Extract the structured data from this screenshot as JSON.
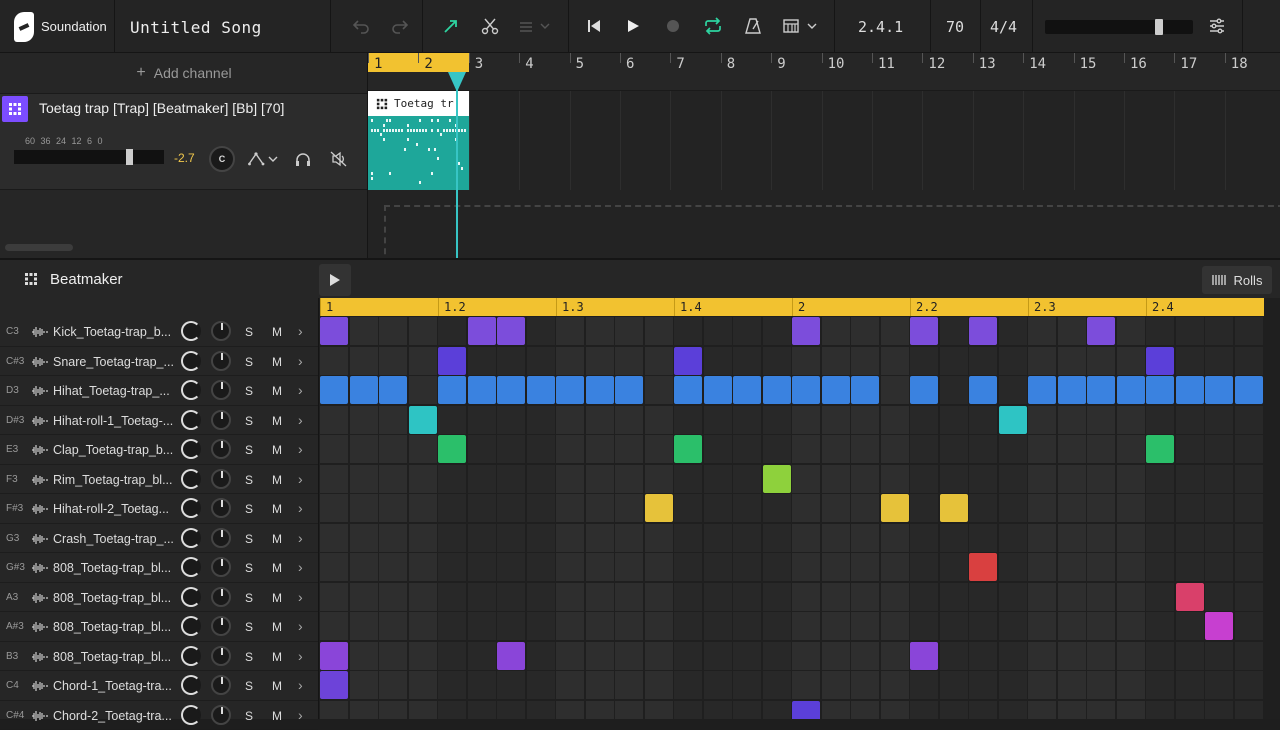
{
  "app": {
    "name": "Soundation",
    "song_title": "Untitled Song"
  },
  "toolbar": {
    "position": "2.4.1",
    "tempo": "70",
    "time_signature": "4/4",
    "master_volume": 0.78
  },
  "arrangement": {
    "add_channel_label": "Add channel",
    "bar_numbers": [
      "1",
      "2",
      "3",
      "4",
      "5",
      "6",
      "7",
      "8",
      "9",
      "10",
      "11",
      "12",
      "13",
      "14",
      "15",
      "16",
      "17",
      "18"
    ],
    "track": {
      "name": "Toetag trap [Trap] [Beatmaker] [Bb] [70]",
      "meter_labels": "60 36 24   12  6   0",
      "gain": "-2.7",
      "pan": "C",
      "clip_name": "Toetag tr",
      "volume": 0.78
    }
  },
  "beatmaker": {
    "title": "Beatmaker",
    "rolls_label": "Rolls",
    "solo_label": "S",
    "mute_label": "M",
    "beat_labels": [
      {
        "label": "1",
        "step": 0
      },
      {
        "label": "1.2",
        "step": 4
      },
      {
        "label": "1.3",
        "step": 8
      },
      {
        "label": "1.4",
        "step": 12
      },
      {
        "label": "2",
        "step": 16
      },
      {
        "label": "2.2",
        "step": 20
      },
      {
        "label": "2.3",
        "step": 24
      },
      {
        "label": "2.4",
        "step": 28
      }
    ],
    "rows": [
      {
        "note": "C3",
        "name": "Kick_Toetag-trap_b...",
        "color": "#7c4ddb",
        "steps": [
          0,
          5,
          6,
          16,
          20,
          22,
          26
        ]
      },
      {
        "note": "C#3",
        "name": "Snare_Toetag-trap_...",
        "color": "#5b3fd9",
        "steps": [
          4,
          12,
          28
        ]
      },
      {
        "note": "D3",
        "name": "Hihat_Toetag-trap_...",
        "color": "#3a82e0",
        "steps": [
          0,
          1,
          2,
          4,
          5,
          6,
          7,
          8,
          9,
          10,
          12,
          13,
          14,
          15,
          16,
          17,
          18,
          20,
          22,
          24,
          25,
          26,
          27,
          28,
          29,
          30,
          31
        ]
      },
      {
        "note": "D#3",
        "name": "Hihat-roll-1_Toetag-...",
        "color": "#2ec4c4",
        "steps": [
          3,
          23
        ]
      },
      {
        "note": "E3",
        "name": "Clap_Toetag-trap_b...",
        "color": "#2bbf6a",
        "steps": [
          4,
          12,
          28
        ]
      },
      {
        "note": "F3",
        "name": "Rim_Toetag-trap_bl...",
        "color": "#8ed13c",
        "steps": [
          15
        ]
      },
      {
        "note": "F#3",
        "name": "Hihat-roll-2_Toetag...",
        "color": "#e6c23a",
        "steps": [
          11,
          19,
          21
        ]
      },
      {
        "note": "G3",
        "name": "Crash_Toetag-trap_...",
        "color": "#e6c23a",
        "steps": []
      },
      {
        "note": "G#3",
        "name": "808_Toetag-trap_bl...",
        "color": "#d94040",
        "steps": [
          22
        ]
      },
      {
        "note": "A3",
        "name": "808_Toetag-trap_bl...",
        "color": "#d9406a",
        "steps": [
          29
        ]
      },
      {
        "note": "A#3",
        "name": "808_Toetag-trap_bl...",
        "color": "#c73fd0",
        "steps": [
          30
        ]
      },
      {
        "note": "B3",
        "name": "808_Toetag-trap_bl...",
        "color": "#8a45d9",
        "steps": [
          0,
          6,
          20
        ]
      },
      {
        "note": "C4",
        "name": "Chord-1_Toetag-tra...",
        "color": "#6d43d9",
        "steps": [
          0
        ]
      },
      {
        "note": "C#4",
        "name": "Chord-2_Toetag-tra...",
        "color": "#5b3fd9",
        "steps": [
          16
        ]
      }
    ]
  }
}
